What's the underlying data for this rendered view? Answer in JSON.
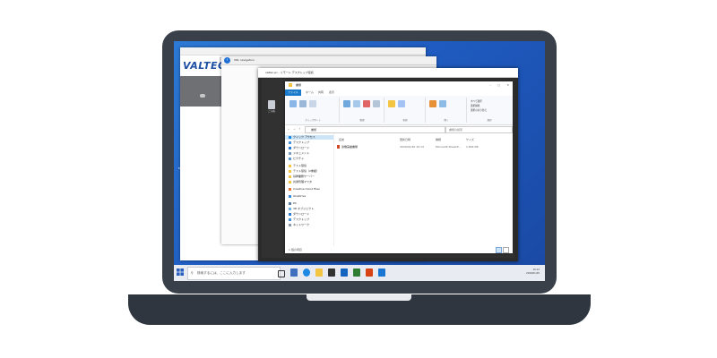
{
  "browser_back": {
    "title": "",
    "address": "https://www.valtec.co.jp/ ... .html",
    "logo_text": "VALTEC"
  },
  "browser_mid": {
    "title": "URL navigation"
  },
  "rdp": {
    "title": "valtec-pc - リモート デスクトップ接続",
    "recycle_label": "ごみ箱"
  },
  "desktop_icons": [
    {
      "name": "shortcut-icon-1",
      "label": "VPN Client",
      "color": "#c62828"
    },
    {
      "name": "shortcut-icon-2",
      "label": "ReGHelp",
      "color": "#d84315"
    },
    {
      "name": "edge-icon",
      "label": "Microsoft Edge",
      "color": "#1e88e5"
    }
  ],
  "explorer": {
    "title": "書類",
    "tabs": [
      "ファイル",
      "ホーム",
      "共有",
      "表示"
    ],
    "ribbon_groups": [
      "クリップボード",
      "整理",
      "新規",
      "開く",
      "選択"
    ],
    "ribbon_select": [
      "すべて選択",
      "選択解除",
      "選択の切り替え"
    ],
    "path": "書類",
    "search_placeholder": "書類の検索",
    "nav_items": [
      {
        "label": "クイック アクセス",
        "selected": true
      },
      {
        "label": "デスクトップ"
      },
      {
        "label": "ダウンロード"
      },
      {
        "label": "ドキュメント"
      },
      {
        "label": "ピクチャ"
      },
      {
        "label": "テスト環境"
      },
      {
        "label": "テスト環境（2重複）"
      },
      {
        "label": "基幹業務サーバー"
      },
      {
        "label": "共通管理マスタ"
      },
      {
        "label": "Creative Cloud Files"
      },
      {
        "label": "OneDrive"
      },
      {
        "label": "PC"
      },
      {
        "label": "3D オブジェクト"
      },
      {
        "label": "ダウンロード"
      },
      {
        "label": "デスクトップ"
      },
      {
        "label": "ネットワーク"
      }
    ],
    "columns": [
      "名前",
      "更新日時",
      "種類",
      "サイズ"
    ],
    "files": [
      {
        "name": "労働実績書類",
        "modified": "2020/01/20 10:13",
        "type": "Microsoft PowerP...",
        "size": "1,824 KB"
      }
    ],
    "status": "1 個の項目"
  },
  "taskbar": {
    "search_placeholder": "検索するには、ここに入力します",
    "time": "10:12",
    "date": "2020/01/20"
  }
}
